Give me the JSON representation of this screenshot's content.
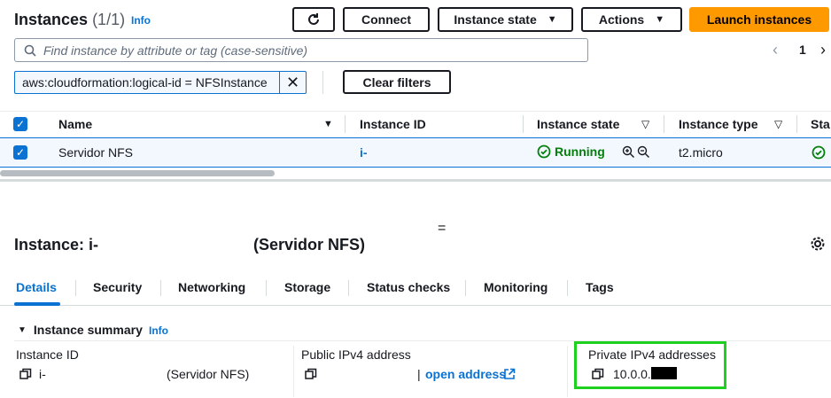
{
  "header": {
    "title": "Instances",
    "count": "(1/1)",
    "info": "Info",
    "buttons": {
      "connect": "Connect",
      "instance_state": "Instance state",
      "actions": "Actions",
      "launch": "Launch instances"
    },
    "search_placeholder": "Find instance by attribute or tag (case-sensitive)",
    "filter_chip": "aws:cloudformation:logical-id = NFSInstance",
    "clear_filters": "Clear filters",
    "page_number": "1"
  },
  "table": {
    "columns": [
      "Name",
      "Instance ID",
      "Instance state",
      "Instance type",
      "Sta"
    ],
    "row": {
      "name": "Servidor NFS",
      "instance_id": "i-",
      "state": "Running",
      "type": "t2.micro"
    }
  },
  "detail": {
    "title_prefix": "Instance: i-",
    "title_suffix": "(Servidor NFS)",
    "handle": "=",
    "tabs": [
      "Details",
      "Security",
      "Networking",
      "Storage",
      "Status checks",
      "Monitoring",
      "Tags"
    ],
    "active_tab": "Details",
    "summary_title": "Instance summary",
    "summary_info": "Info",
    "fields": {
      "instance_id_label": "Instance ID",
      "instance_id_value": "i-",
      "instance_id_name": "(Servidor NFS)",
      "public_ipv4_label": "Public IPv4 address",
      "public_ipv4_sep": "|",
      "public_ipv4_link": "open address",
      "private_ipv4_label": "Private IPv4 addresses",
      "private_ipv4_value": "10.0.0."
    }
  },
  "colors": {
    "accent": "#0972d3",
    "primary_button": "#ff9900",
    "running": "#037f0c",
    "highlight_box": "#1fd11f"
  },
  "icons": [
    "refresh-icon",
    "search-icon",
    "close-icon",
    "chevron-left-icon",
    "chevron-right-icon",
    "settings-icon",
    "copy-icon",
    "external-link-icon",
    "zoom-in-icon",
    "zoom-out-icon",
    "check-circle-icon",
    "caret-down-icon",
    "sort-icon"
  ]
}
